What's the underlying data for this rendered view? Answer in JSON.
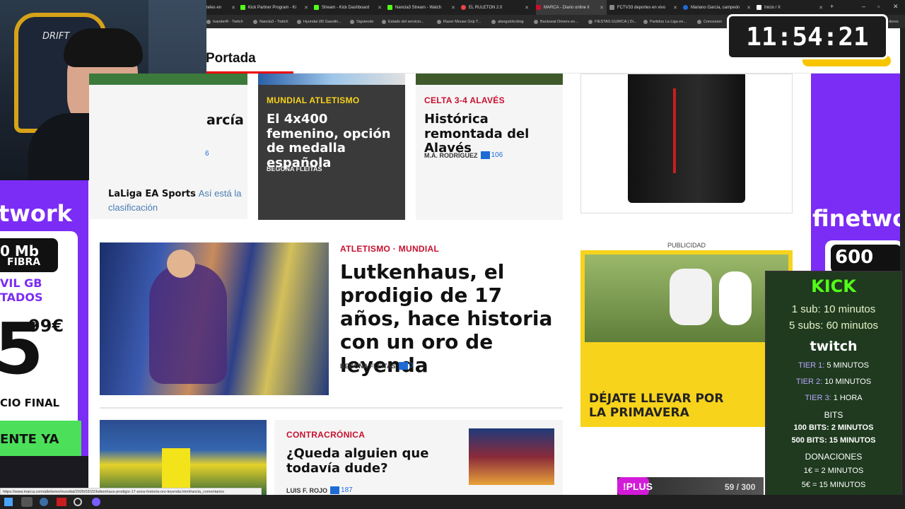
{
  "browser": {
    "tabs": [
      {
        "label": "teles en",
        "color": "#888"
      },
      {
        "label": "Kick Partner Program - Ki",
        "color": "#53fc18"
      },
      {
        "label": "Stream - Kick Dashboard",
        "color": "#53fc18"
      },
      {
        "label": "Nancla3 Stream - Watch",
        "color": "#53fc18"
      },
      {
        "label": "EL RULETON 2.0",
        "color": "#e44"
      },
      {
        "label": "MARCA - Diario online lí",
        "color": "#c8102e"
      },
      {
        "label": "FCTV33 deportes en vivo",
        "color": "#888"
      },
      {
        "label": "Mariano García, campeón",
        "color": "#1e6bd6"
      },
      {
        "label": "Inicio / X",
        "color": "#fff"
      }
    ],
    "bookmarks": [
      "tvanderR - Twitch",
      "Nancla3 - Twitch",
      "Hyundai i30 Gasolin...",
      "Siguiendo",
      "Estado del servicio...",
      "Razer Mouse Grip T...",
      "alangulotv.blog",
      "Backseat Drivers en...",
      "FIESTAS GUIRCA | Di...",
      "Partidos La Liga en...",
      "Concesion",
      "dores"
    ],
    "status_url": "https://www.marca.com/atletismo/mundial/2026/03/22/lutkenhaus-prodigio-17-anos-historia-oro-leyenda.html#ancla_comentarios"
  },
  "site": {
    "section_title": "Portada",
    "accent_color": "#c8102e"
  },
  "cards_top": [
    {
      "id": "partial",
      "headline": "arcía",
      "extra": "6"
    },
    {
      "id": "atletismo",
      "kicker": "MUNDIAL ATLETISMO",
      "headline": "El 4x400 femenino, opción de medalla española",
      "author": "BEGOÑA FLEITAS"
    },
    {
      "id": "celta",
      "kicker": "CELTA 3-4 ALAVÉS",
      "headline": "Histórica remontada del Alavés",
      "author": "M.Á. RODRÍGUEZ",
      "comments": "106"
    }
  ],
  "laliga": {
    "bold": "LaLiga EA Sports",
    "text": "Así está la clasificación"
  },
  "main_story": {
    "kicker": "ATLETISMO · MUNDIAL",
    "headline": "Lutkenhaus, el prodigio de 17 años, hace historia con un oro de leyenda",
    "author": "BEGOÑA FLEITAS",
    "comments": "0"
  },
  "story2": {
    "kicker": "CONTRACRÓNICA",
    "headline": "¿Queda alguien que todavía dude?",
    "author": "LUIS F. ROJO",
    "comments": "187"
  },
  "ads": {
    "publicidad_label": "PUBLICIDAD",
    "primavera_text": "DÉJATE LLEVAR POR LA PRIMAVERA",
    "left_ad": {
      "brand": "twork",
      "line1": "0 Mb",
      "line2": "FIBRA",
      "line3": "VIL GB",
      "line4": "TADOS",
      "price": "5",
      "cents": "99€",
      "final": "CIO FINAL",
      "cta": "ENTE YA"
    },
    "right_ad": {
      "brand": "finetwo",
      "line1": "600",
      "line2": "FIE"
    }
  },
  "overlay": {
    "clock": "11:54:21",
    "kick_panel": {
      "kick_title": "KICK",
      "kick_lines": [
        "1 sub: 10 minutos",
        "5 subs: 60 minutos"
      ],
      "twitch_title": "twitch",
      "tiers": [
        {
          "tier": "TIER 1:",
          "value": "5 MINUTOS"
        },
        {
          "tier": "TIER 2:",
          "value": "10 MINUTOS"
        },
        {
          "tier": "TIER 3:",
          "value": "1 HORA"
        }
      ],
      "bits_title": "BITS",
      "bits": [
        "100 BITS: 2 MINUTOS",
        "500 BITS: 15 MINUTOS"
      ],
      "donaciones_title": "DONACIONES",
      "donaciones": [
        "1€ = 2 MINUTOS",
        "5€ = 15 MINUTOS"
      ]
    },
    "plus": {
      "label": "!PLUS",
      "count": "59 / 300"
    }
  }
}
